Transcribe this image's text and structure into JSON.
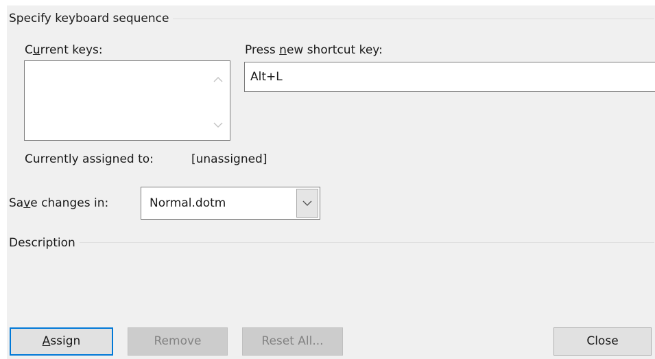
{
  "keyboard_group": {
    "title": "Specify keyboard sequence"
  },
  "current_keys": {
    "label_pre": "C",
    "label_key": "u",
    "label_post": "rrent keys:",
    "items": []
  },
  "new_shortcut": {
    "label_pre": "Press ",
    "label_key": "n",
    "label_post": "ew shortcut key:",
    "value": "Alt+L"
  },
  "assignment": {
    "label": "Currently assigned to:",
    "value": "[unassigned]"
  },
  "save_in": {
    "label_pre": "Sa",
    "label_key": "v",
    "label_post": "e changes in:",
    "selected": "Normal.dotm"
  },
  "description_group": {
    "title": "Description"
  },
  "buttons": {
    "assign_key": "A",
    "assign_rest": "ssign",
    "remove": "Remove",
    "reset_all": "Reset All...",
    "close": "Close"
  },
  "icons": {
    "scroll_up": "chevron-up-icon",
    "scroll_down": "chevron-down-icon",
    "dropdown": "chevron-down-icon"
  },
  "colors": {
    "dialog_bg": "#f0f0f0",
    "default_button_border": "#0078d7",
    "disabled_text": "#838383"
  }
}
